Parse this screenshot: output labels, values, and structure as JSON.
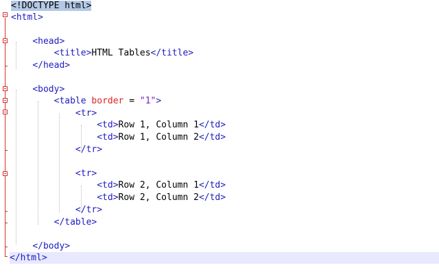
{
  "editor": {
    "doctype": "<!DOCTYPE html>",
    "html_open": "<html>",
    "head_open": "<head>",
    "title_open": "<title>",
    "title_text": "HTML Tables",
    "title_close": "</title>",
    "head_close": "</head>",
    "body_open": "<body>",
    "table_tag": "<table",
    "table_attr": "border",
    "table_eq": " = ",
    "table_val": "\"1\"",
    "table_end": ">",
    "tr_open": "<tr>",
    "td_open": "<td>",
    "td_close": "</td>",
    "cells": [
      "Row 1, Column 1",
      "Row 1, Column 2",
      "Row 2, Column 1",
      "Row 2, Column 2"
    ],
    "tr_close": "</tr>",
    "table_close": "</table>",
    "body_close": "</body>",
    "html_close": "</html>"
  },
  "colors": {
    "tag": "#1c1cc0",
    "attribute": "#e02020",
    "value": "#7a1cc8",
    "fold_marker": "#d03030",
    "current_line": "#e8e8ff"
  }
}
